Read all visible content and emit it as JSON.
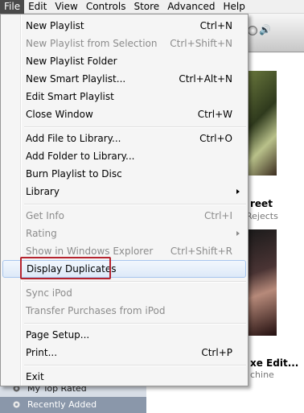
{
  "menubar": {
    "items": [
      "File",
      "Edit",
      "View",
      "Controls",
      "Store",
      "Advanced",
      "Help"
    ]
  },
  "background": {
    "album1": {
      "title": "reet",
      "subtitle": "Rejects"
    },
    "album2": {
      "title": "xe Edit...",
      "subtitle": "chine"
    },
    "sidebar": {
      "top_rated": "My Top Rated",
      "recently_added": "Recently Added"
    }
  },
  "file_menu": {
    "new_playlist": {
      "label": "New Playlist",
      "shortcut": "Ctrl+N"
    },
    "new_playlist_from_selection": {
      "label": "New Playlist from Selection",
      "shortcut": "Ctrl+Shift+N"
    },
    "new_playlist_folder": {
      "label": "New Playlist Folder"
    },
    "new_smart_playlist": {
      "label": "New Smart Playlist...",
      "shortcut": "Ctrl+Alt+N"
    },
    "edit_smart_playlist": {
      "label": "Edit Smart Playlist"
    },
    "close_window": {
      "label": "Close Window",
      "shortcut": "Ctrl+W"
    },
    "add_file": {
      "label": "Add File to Library...",
      "shortcut": "Ctrl+O"
    },
    "add_folder": {
      "label": "Add Folder to Library..."
    },
    "burn_playlist": {
      "label": "Burn Playlist to Disc"
    },
    "library": {
      "label": "Library"
    },
    "get_info": {
      "label": "Get Info",
      "shortcut": "Ctrl+I"
    },
    "rating": {
      "label": "Rating"
    },
    "show_in_explorer": {
      "label": "Show in Windows Explorer",
      "shortcut": "Ctrl+Shift+R"
    },
    "display_duplicates": {
      "label": "Display Duplicates"
    },
    "sync_ipod": {
      "label": "Sync iPod"
    },
    "transfer_purchases": {
      "label": "Transfer Purchases from iPod"
    },
    "page_setup": {
      "label": "Page Setup..."
    },
    "print": {
      "label": "Print...",
      "shortcut": "Ctrl+P"
    },
    "exit": {
      "label": "Exit"
    }
  },
  "colors": {
    "highlight_box": "#b5232e",
    "hover_border": "#a8c6ee",
    "disabled_text": "#8c8c8c"
  }
}
